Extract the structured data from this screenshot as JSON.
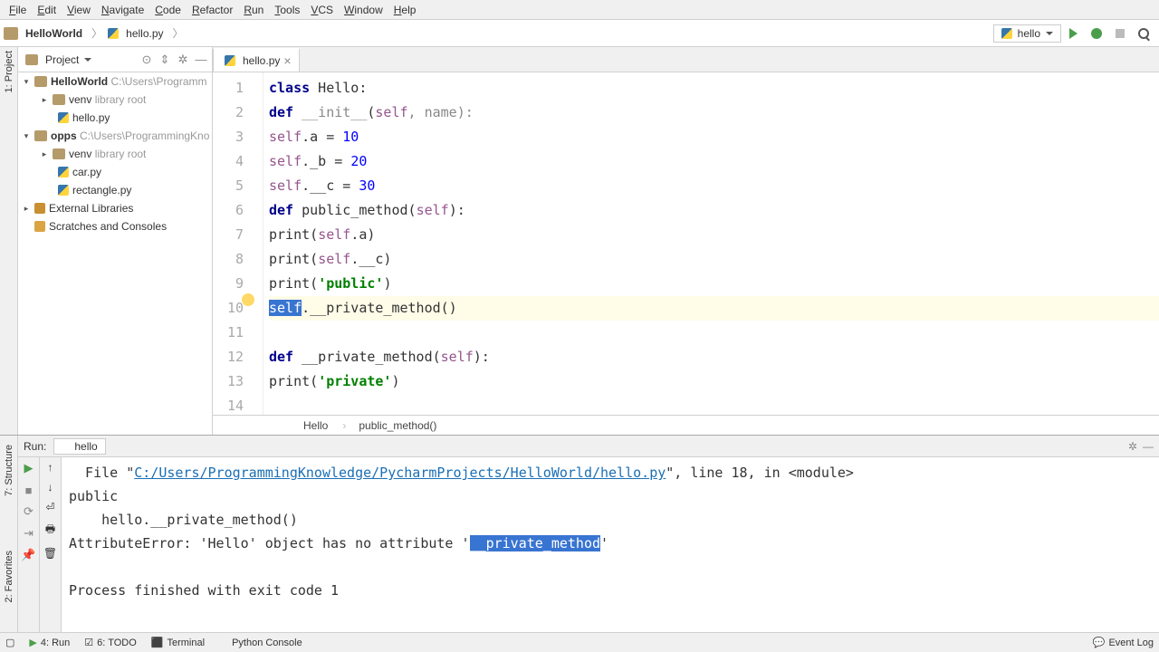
{
  "menu": [
    "File",
    "Edit",
    "View",
    "Navigate",
    "Code",
    "Refactor",
    "Run",
    "Tools",
    "VCS",
    "Window",
    "Help"
  ],
  "breadcrumb": {
    "project": "HelloWorld",
    "file": "hello.py"
  },
  "run_config": "hello",
  "project_pane": {
    "title": "Project"
  },
  "tree": {
    "root": {
      "name": "HelloWorld",
      "path": "C:\\Users\\Programm"
    },
    "venv1": {
      "name": "venv",
      "hint": "library root"
    },
    "file1": "hello.py",
    "opps": {
      "name": "opps",
      "path": "C:\\Users\\ProgrammingKno"
    },
    "venv2": {
      "name": "venv",
      "hint": "library root"
    },
    "file2": "car.py",
    "file3": "rectangle.py",
    "ext": "External Libraries",
    "scratch": "Scratches and Consoles"
  },
  "tab": "hello.py",
  "code": {
    "l1a": "class",
    "l1b": " Hello:",
    "l2a": "def",
    "l2b": "__init__",
    "l2c": "self",
    "l2d": ", name):",
    "l3a": "self",
    "l3b": ".a = ",
    "l3c": "10",
    "l4a": "self",
    "l4b": "._b = ",
    "l4c": "20",
    "l5a": "self",
    "l5b": ".__c = ",
    "l5c": "30",
    "l6a": "def",
    "l6b": " public_method(",
    "l6c": "self",
    "l6d": "):",
    "l7a": "print(",
    "l7b": "self",
    "l7c": ".a)",
    "l8a": "print(",
    "l8b": "self",
    "l8c": ".__c)",
    "l9a": "print(",
    "l9b": "'public'",
    "l9c": ")",
    "l10a": "self",
    "l10b": ".__private_method()",
    "l12a": "def",
    "l12b": " __private_method(",
    "l12c": "self",
    "l12d": "):",
    "l13a": "print(",
    "l13b": "'private'",
    "l13c": ")"
  },
  "lines": [
    "1",
    "2",
    "3",
    "4",
    "5",
    "6",
    "7",
    "8",
    "9",
    "10",
    "11",
    "12",
    "13",
    "14"
  ],
  "bc_bottom": {
    "a": "Hello",
    "b": "public_method()"
  },
  "run": {
    "label": "Run:",
    "tab": "hello",
    "out1a": "  File \"",
    "out1b": "C:/Users/ProgrammingKnowledge/PycharmProjects/HelloWorld/hello.py",
    "out1c": "\", line 18, in <module>",
    "out2": "public",
    "out3": "    hello.__private_method()",
    "out4a": "AttributeError: 'Hello' object has no attribute '",
    "out4b": "__private_method",
    "out4c": "'",
    "out5": "",
    "out6": "Process finished with exit code 1"
  },
  "bottom": {
    "run": "4: Run",
    "todo": "6: TODO",
    "term": "Terminal",
    "pyc": "Python Console",
    "evlog": "Event Log"
  },
  "edge": {
    "project": "1: Project",
    "structure": "7: Structure",
    "fav": "2: Favorites"
  }
}
